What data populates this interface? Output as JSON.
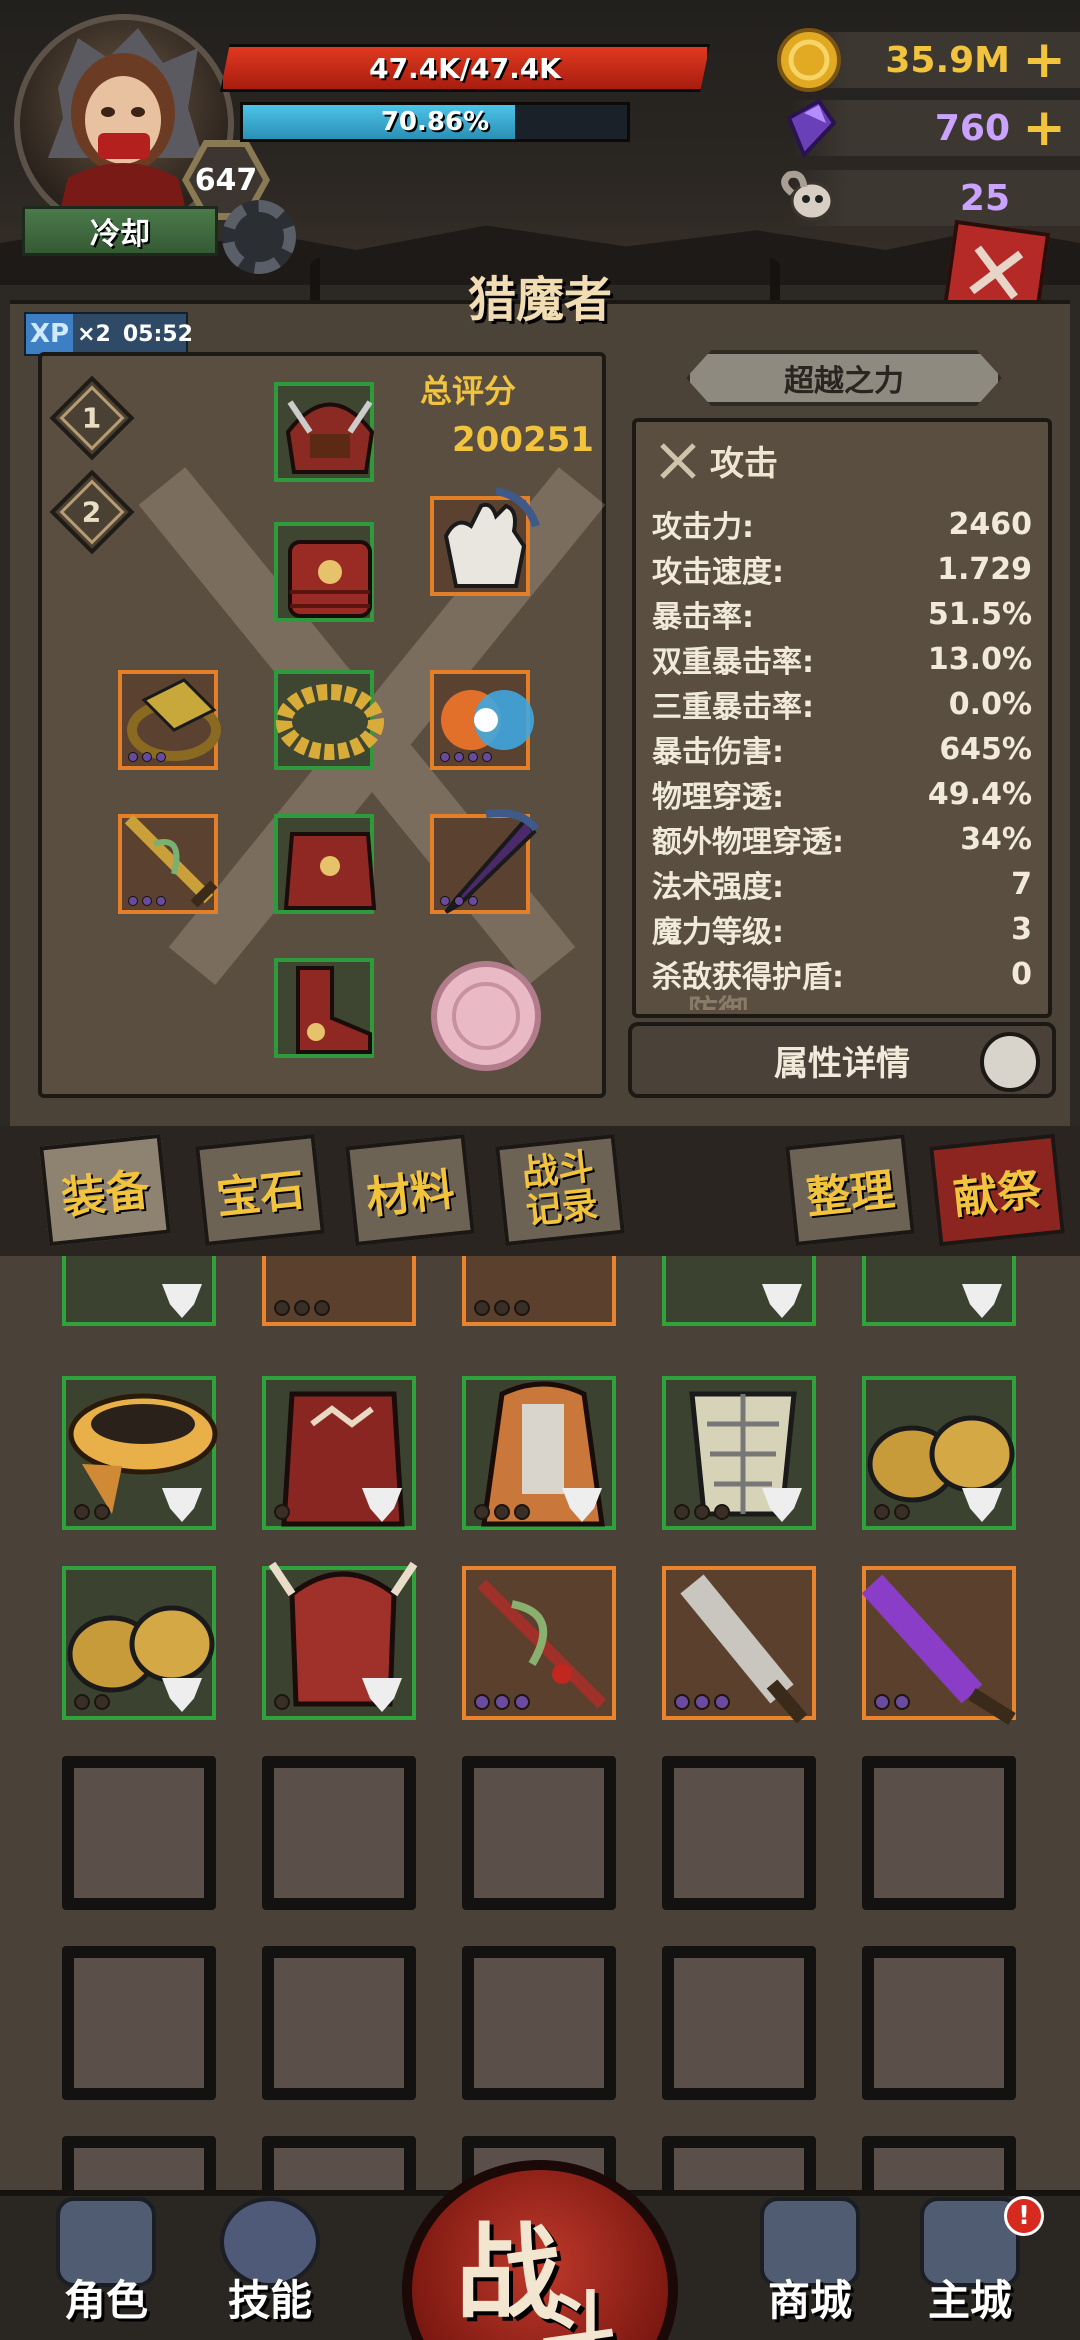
{
  "player": {
    "name": "冷却",
    "level": "647",
    "hp_text": "47.4K/47.4K",
    "hp_fraction": 1.0,
    "xp_text": "70.86%",
    "xp_fraction": 0.7086
  },
  "resources": {
    "gold": "35.9M",
    "crystals": "760",
    "skulls": "25"
  },
  "xp_boost": {
    "tag": "XP",
    "multiplier": "×2",
    "timer": "05:52"
  },
  "title": "猎魔者",
  "loadouts": [
    "1",
    "2"
  ],
  "score": {
    "label": "总评分",
    "value": "200251"
  },
  "transcend_label": "超越之力",
  "stats": {
    "header": "攻击",
    "rows": [
      {
        "label": "攻击力:",
        "value": "2460"
      },
      {
        "label": "攻击速度:",
        "value": "1.729"
      },
      {
        "label": "暴击率:",
        "value": "51.5%"
      },
      {
        "label": "双重暴击率:",
        "value": "13.0%"
      },
      {
        "label": "三重暴击率:",
        "value": "0.0%"
      },
      {
        "label": "暴击伤害:",
        "value": "645%"
      },
      {
        "label": "物理穿透:",
        "value": "49.4%"
      },
      {
        "label": "额外物理穿透:",
        "value": "34%"
      },
      {
        "label": "法术强度:",
        "value": "7"
      },
      {
        "label": "魔力等级:",
        "value": "3"
      },
      {
        "label": "杀敌获得护盾:",
        "value": "0"
      }
    ],
    "next_section": "防御"
  },
  "detail_button": "属性详情",
  "tabs": {
    "equipment": "装备",
    "gems": "宝石",
    "materials": "材料",
    "battle_log_1": "战斗",
    "battle_log_2": "记录",
    "sort": "整理",
    "sacrifice": "献祭"
  },
  "nav": {
    "character": "角色",
    "skills": "技能",
    "battle_1": "战",
    "battle_2": "斗",
    "shop": "商城",
    "city": "主城",
    "alert": "!"
  },
  "colors": {
    "hp": "#c62a18",
    "xp": "#3fb0d8",
    "gold_text": "#f2c33d",
    "crystal_text": "#c9a3ff",
    "rarity_green": "#2fa23c",
    "rarity_orange": "#e9842c"
  }
}
